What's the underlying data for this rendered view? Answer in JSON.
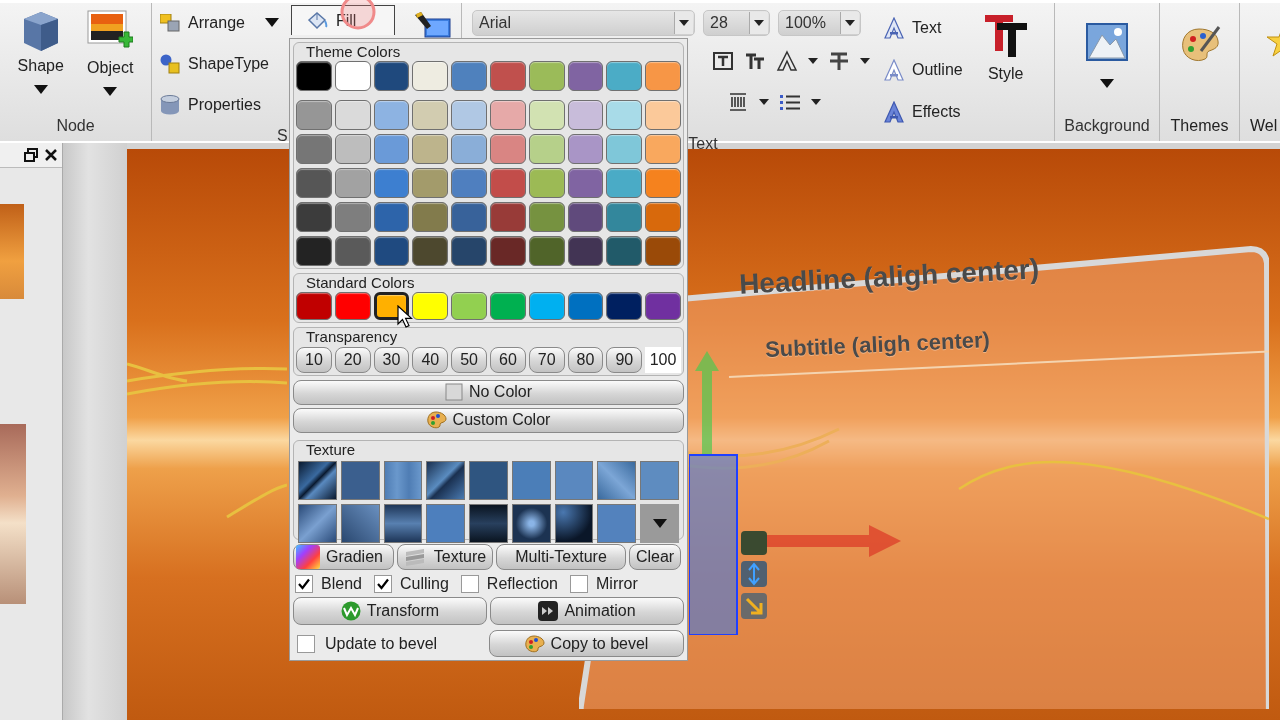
{
  "ribbon": {
    "node_group": {
      "buttons": [
        "Shape",
        "Object"
      ],
      "label": "Node"
    },
    "shape_group": {
      "items": [
        "Arrange",
        "ShapeType",
        "Properties"
      ],
      "label": "S"
    },
    "fill_button": {
      "label": "Fill",
      "selected": true
    },
    "font": {
      "family": "Arial",
      "size": "28",
      "zoom": "100%"
    },
    "text_group": {
      "items": [
        "Text",
        "Outline",
        "Effects"
      ],
      "label": "Text"
    },
    "style_button": "Style",
    "background_group": {
      "label": "Background"
    },
    "themes_button": "Themes",
    "cut_button": "Wel"
  },
  "fill_popup": {
    "theme_colors": {
      "title": "Theme Colors",
      "rows": [
        [
          {
            "color": "#000000"
          },
          {
            "color": "#ffffff"
          },
          {
            "color": "#1f497d"
          },
          {
            "color": "#eeece1"
          },
          {
            "color": "#4f81bd"
          },
          {
            "color": "#c0504d"
          },
          {
            "color": "#9bbb59"
          },
          {
            "color": "#8064a2"
          },
          {
            "color": "#4bacc6"
          },
          {
            "color": "#f79646"
          }
        ],
        [
          {
            "color": "#969696"
          },
          {
            "color": "#dadada"
          },
          {
            "color": "#8db3e2"
          },
          {
            "color": "#d2ccb0"
          },
          {
            "color": "#b0c8e4"
          },
          {
            "color": "#e6a9a8"
          },
          {
            "color": "#d2e2b2"
          },
          {
            "color": "#c8bcda"
          },
          {
            "color": "#a8dbe8"
          },
          {
            "color": "#fbc99a"
          }
        ],
        [
          {
            "color": "#767676"
          },
          {
            "color": "#bdbdbd"
          },
          {
            "color": "#6a9ad8"
          },
          {
            "color": "#bdb48c"
          },
          {
            "color": "#8aaed8"
          },
          {
            "color": "#d98583"
          },
          {
            "color": "#b6d08a"
          },
          {
            "color": "#a995c6"
          },
          {
            "color": "#7fc7d9"
          },
          {
            "color": "#f9a85e"
          }
        ],
        [
          {
            "color": "#565656"
          },
          {
            "color": "#a2a2a2"
          },
          {
            "color": "#3d7fd0"
          },
          {
            "color": "#a39b6b"
          },
          {
            "color": "#4f7fbf"
          },
          {
            "color": "#c24d4a"
          },
          {
            "color": "#9cba55"
          },
          {
            "color": "#8064a2"
          },
          {
            "color": "#4aabc6"
          },
          {
            "color": "#f5821e"
          }
        ],
        [
          {
            "color": "#3c3c3c"
          },
          {
            "color": "#7e7e7e"
          },
          {
            "color": "#2d64aa"
          },
          {
            "color": "#827b4c"
          },
          {
            "color": "#38629a"
          },
          {
            "color": "#983b38"
          },
          {
            "color": "#769240"
          },
          {
            "color": "#604a7c"
          },
          {
            "color": "#33879c"
          },
          {
            "color": "#d8690c"
          }
        ],
        [
          {
            "color": "#232323"
          },
          {
            "color": "#5a5a5a"
          },
          {
            "color": "#1f4a80"
          },
          {
            "color": "#4d482e"
          },
          {
            "color": "#26456a"
          },
          {
            "color": "#692826"
          },
          {
            "color": "#506429"
          },
          {
            "color": "#423454"
          },
          {
            "color": "#215a69"
          },
          {
            "color": "#9a4a08"
          }
        ]
      ]
    },
    "standard_colors": {
      "title": "Standard Colors",
      "colors": [
        {
          "color": "#c00000",
          "selected": false
        },
        {
          "color": "#ff0000",
          "selected": false
        },
        {
          "color": "#ffb000",
          "selected": true
        },
        {
          "color": "#ffff00",
          "selected": false
        },
        {
          "color": "#92d050",
          "selected": false
        },
        {
          "color": "#00b050",
          "selected": false
        },
        {
          "color": "#00b0f0",
          "selected": false
        },
        {
          "color": "#0070c0",
          "selected": false
        },
        {
          "color": "#002060",
          "selected": false
        },
        {
          "color": "#7030a0",
          "selected": false
        }
      ]
    },
    "transparency": {
      "title": "Transparency",
      "options": [
        {
          "label": "10",
          "selected": false
        },
        {
          "label": "20",
          "selected": false
        },
        {
          "label": "30",
          "selected": false
        },
        {
          "label": "40",
          "selected": false
        },
        {
          "label": "50",
          "selected": false
        },
        {
          "label": "60",
          "selected": false
        },
        {
          "label": "70",
          "selected": false
        },
        {
          "label": "80",
          "selected": false
        },
        {
          "label": "90",
          "selected": false
        },
        {
          "label": "100",
          "selected": true
        }
      ]
    },
    "no_color": "No Color",
    "custom_color": "Custom Color",
    "texture": {
      "title": "Texture"
    },
    "texture_buttons": [
      "Gradien",
      "Texture",
      "Multi-Texture",
      "Clear"
    ],
    "options": [
      {
        "label": "Blend",
        "checked": true
      },
      {
        "label": "Culling",
        "checked": true
      },
      {
        "label": "Reflection",
        "checked": false
      },
      {
        "label": "Mirror",
        "checked": false
      }
    ],
    "transform": "Transform",
    "animation": "Animation",
    "update_to_bevel": {
      "label": "Update to bevel",
      "checked": false
    },
    "copy_to_bevel": "Copy to bevel"
  },
  "slide": {
    "headline": "Headline (aligh center)",
    "subtitle": "Subtitle (aligh center)"
  }
}
